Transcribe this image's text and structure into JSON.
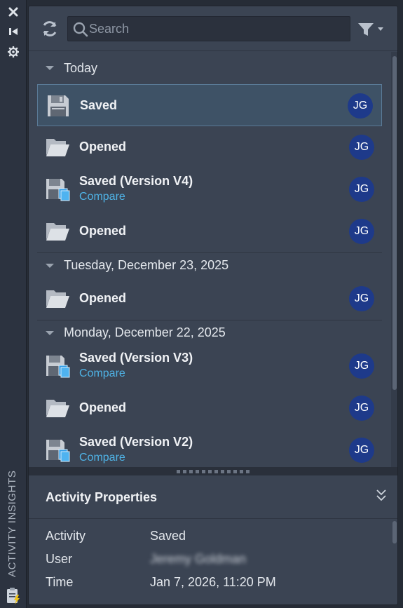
{
  "sidebar": {
    "title": "ACTIVITY INSIGHTS",
    "close_icon": "close-icon",
    "dock_icon": "skip-back-icon",
    "settings_icon": "gear-icon"
  },
  "search": {
    "placeholder": "Search"
  },
  "groups": [
    {
      "label": "Today",
      "items": [
        {
          "title": "Saved",
          "icon": "save-icon",
          "user": "JG",
          "selected": true
        },
        {
          "title": "Opened",
          "icon": "folder-open-icon",
          "user": "JG"
        },
        {
          "title": "Saved (Version V4)",
          "compare": "Compare",
          "icon": "save-version-icon",
          "user": "JG"
        },
        {
          "title": "Opened",
          "icon": "folder-open-icon",
          "user": "JG"
        }
      ]
    },
    {
      "label": "Tuesday, December 23, 2025",
      "items": [
        {
          "title": "Opened",
          "icon": "folder-open-icon",
          "user": "JG"
        }
      ]
    },
    {
      "label": "Monday, December 22, 2025",
      "items": [
        {
          "title": "Saved (Version V3)",
          "compare": "Compare",
          "icon": "save-version-icon",
          "user": "JG"
        },
        {
          "title": "Opened",
          "icon": "folder-open-icon",
          "user": "JG"
        },
        {
          "title": "Saved (Version V2)",
          "compare": "Compare",
          "icon": "save-version-icon",
          "user": "JG"
        }
      ]
    }
  ],
  "properties": {
    "title": "Activity Properties",
    "activity_label": "Activity",
    "activity_value": "Saved",
    "user_label": "User",
    "user_value": "Jeremy Goldman",
    "time_label": "Time",
    "time_value": "Jan 7, 2026, 11:20 PM"
  },
  "colors": {
    "panel_bg": "#3b4453",
    "accent_link": "#4fb3e6",
    "avatar_bg": "#1e3a8a",
    "selected_bg": "#3e5266"
  }
}
